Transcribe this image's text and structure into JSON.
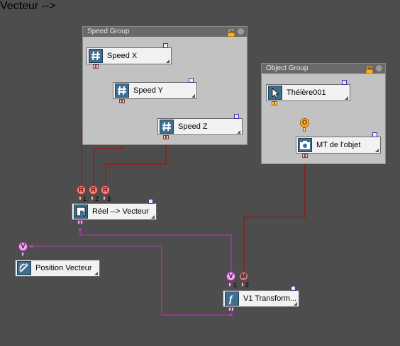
{
  "groups": {
    "speed": {
      "title": "Speed Group"
    },
    "object": {
      "title": "Object Group"
    }
  },
  "nodes": {
    "speed_x": "Speed X",
    "speed_y": "Speed Y",
    "speed_z": "Speed Z",
    "theiere": "Théière001",
    "mt_objet": "MT de l'objet",
    "reel_vecteur": "Réel --> Vecteur",
    "position_vecteur": "Position Vecteur",
    "v1_transform": "V1 Transform..."
  },
  "ports": {
    "r1": "R",
    "r2": "R",
    "r3": "R",
    "r1_num": "1",
    "r2_num": "2",
    "r3_num": "3",
    "o": "O",
    "v_pos": "V",
    "v_in": "V",
    "m_in": "M",
    "v_in_num": "1",
    "m_in_num": "2"
  },
  "colors": {
    "wire_red": "#c00000",
    "wire_purple": "#b040b0",
    "wire_orange": "#ff8800"
  }
}
